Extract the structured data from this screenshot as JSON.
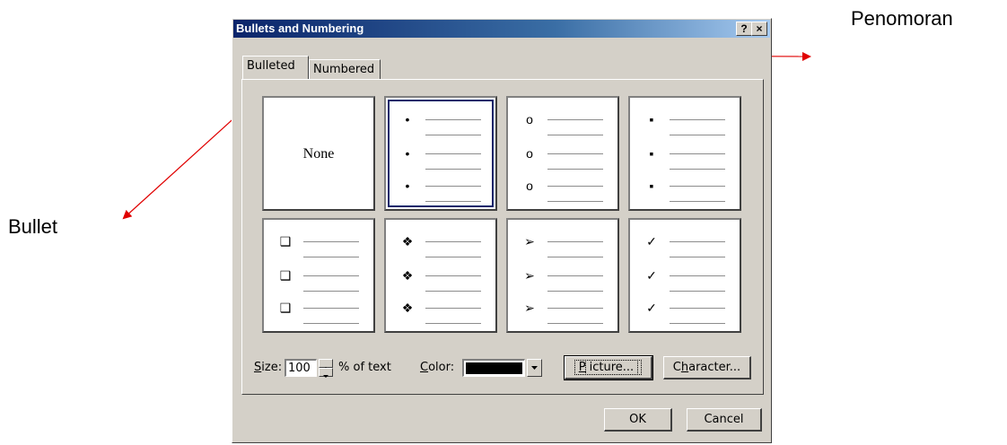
{
  "annotations": {
    "penomoran_label": "Penomoran",
    "bullet_label": "Bullet",
    "arrow_color": "#e00000"
  },
  "dialog": {
    "title": "Bullets and Numbering",
    "help_button": "?",
    "close_button": "×",
    "tabs": [
      {
        "label": "Bulleted",
        "active": true
      },
      {
        "label": "Numbered",
        "active": false
      }
    ],
    "options": [
      {
        "kind": "none",
        "label": "None",
        "selected": false
      },
      {
        "kind": "dot",
        "symbol": "•",
        "selected": true
      },
      {
        "kind": "hollow-circle",
        "symbol": "o",
        "selected": false
      },
      {
        "kind": "square",
        "symbol": "▪",
        "selected": false
      },
      {
        "kind": "hollow-square",
        "symbol": "❑",
        "selected": false
      },
      {
        "kind": "four-diamonds",
        "symbol": "❖",
        "selected": false
      },
      {
        "kind": "arrowhead",
        "symbol": "➢",
        "selected": false
      },
      {
        "kind": "checkmark",
        "symbol": "✓",
        "selected": false
      }
    ],
    "size": {
      "label_accel": "S",
      "label_rest": "ize:",
      "value": "100",
      "suffix": "% of text"
    },
    "color": {
      "label_accel": "C",
      "label_rest": "olor:",
      "value": "#000000"
    },
    "buttons": {
      "picture": {
        "accel": "P",
        "rest": "icture..."
      },
      "character": {
        "pre": "C",
        "accel": "h",
        "rest": "aracter..."
      },
      "ok": "OK",
      "cancel": "Cancel"
    }
  }
}
